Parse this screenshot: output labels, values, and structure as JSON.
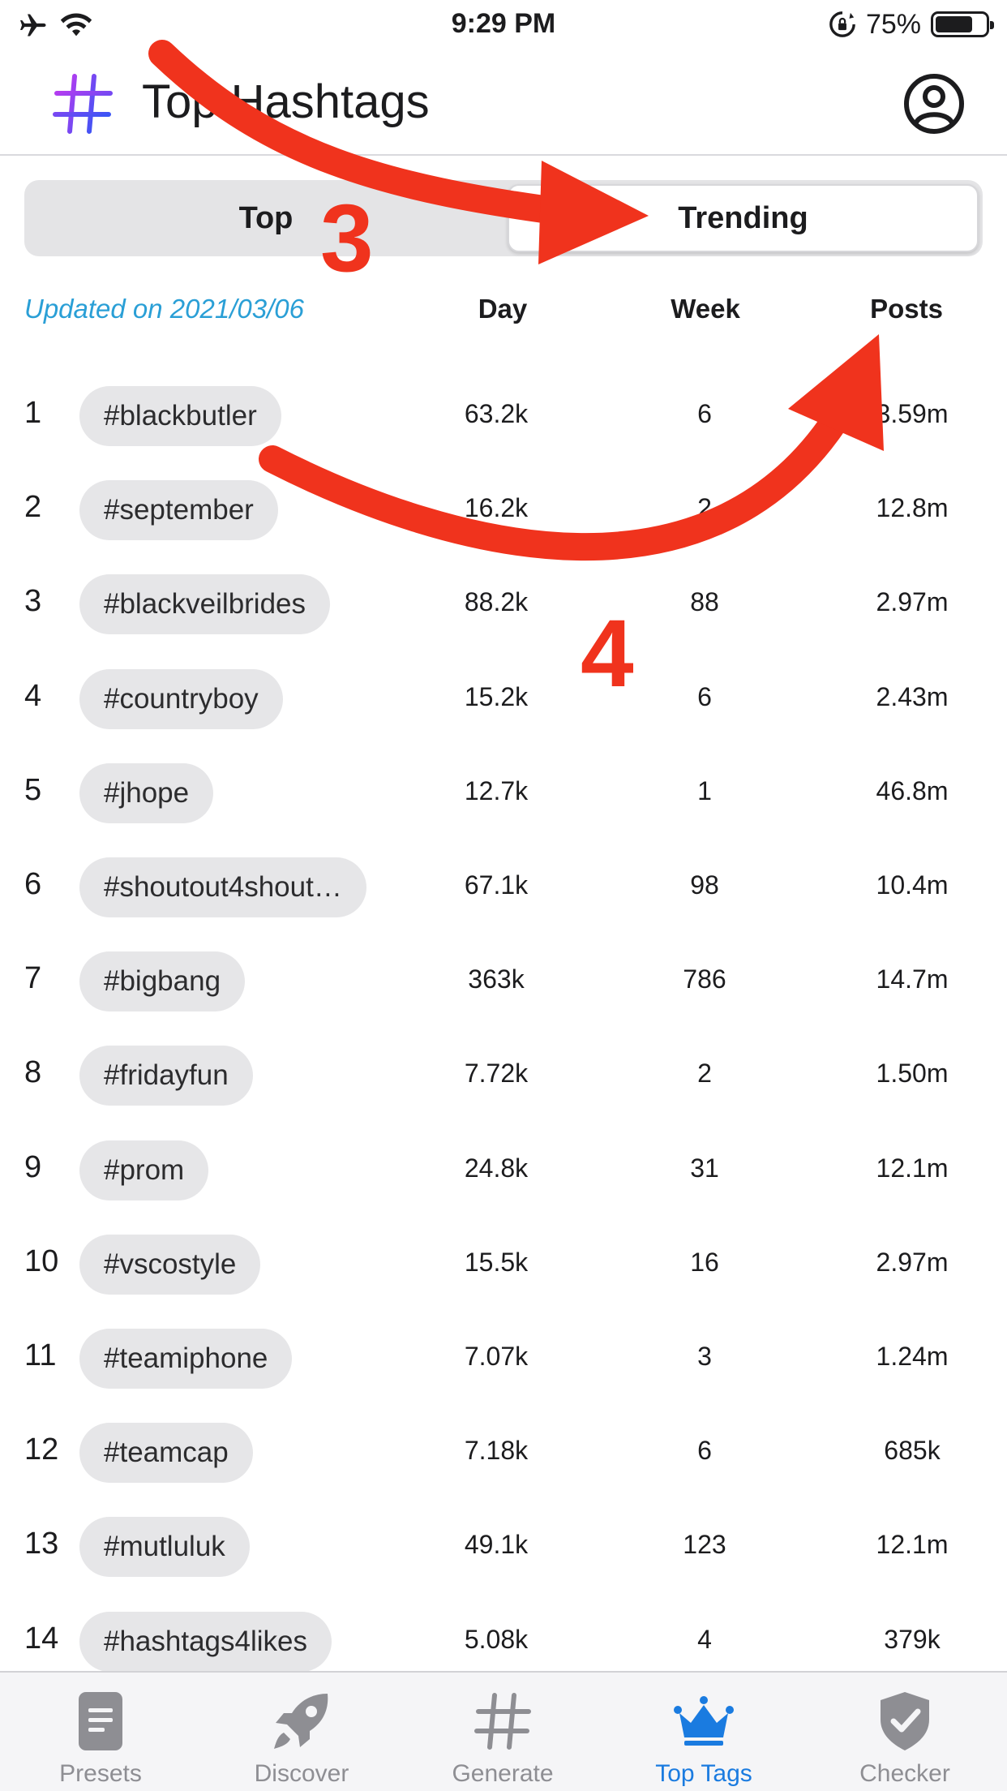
{
  "status_bar": {
    "time": "9:29 PM",
    "battery_percent": "75%",
    "battery_level": 0.75
  },
  "header": {
    "title": "Top Hashtags",
    "logo_icon": "hashtag-logo-icon",
    "profile_icon": "profile-icon"
  },
  "segmented": {
    "top_label": "Top",
    "trending_label": "Trending",
    "selected": "Trending"
  },
  "table": {
    "updated": "Updated on 2021/03/06",
    "headers": {
      "day": "Day",
      "week": "Week",
      "posts": "Posts"
    },
    "rows": [
      {
        "rank": "1",
        "tag": "#blackbutler",
        "day": "63.2k",
        "week": "6",
        "posts": "3.59m"
      },
      {
        "rank": "2",
        "tag": "#september",
        "day": "16.2k",
        "week": "2",
        "posts": "12.8m"
      },
      {
        "rank": "3",
        "tag": "#blackveilbrides",
        "day": "88.2k",
        "week": "88",
        "posts": "2.97m"
      },
      {
        "rank": "4",
        "tag": "#countryboy",
        "day": "15.2k",
        "week": "6",
        "posts": "2.43m"
      },
      {
        "rank": "5",
        "tag": "#jhope",
        "day": "12.7k",
        "week": "1",
        "posts": "46.8m"
      },
      {
        "rank": "6",
        "tag": "#shoutout4shout…",
        "day": "67.1k",
        "week": "98",
        "posts": "10.4m"
      },
      {
        "rank": "7",
        "tag": "#bigbang",
        "day": "363k",
        "week": "786",
        "posts": "14.7m"
      },
      {
        "rank": "8",
        "tag": "#fridayfun",
        "day": "7.72k",
        "week": "2",
        "posts": "1.50m"
      },
      {
        "rank": "9",
        "tag": "#prom",
        "day": "24.8k",
        "week": "31",
        "posts": "12.1m"
      },
      {
        "rank": "10",
        "tag": "#vscostyle",
        "day": "15.5k",
        "week": "16",
        "posts": "2.97m"
      },
      {
        "rank": "11",
        "tag": "#teamiphone",
        "day": "7.07k",
        "week": "3",
        "posts": "1.24m"
      },
      {
        "rank": "12",
        "tag": "#teamcap",
        "day": "7.18k",
        "week": "6",
        "posts": "685k"
      },
      {
        "rank": "13",
        "tag": "#mutluluk",
        "day": "49.1k",
        "week": "123",
        "posts": "12.1m"
      },
      {
        "rank": "14",
        "tag": "#hashtags4likes",
        "day": "5.08k",
        "week": "4",
        "posts": "379k"
      }
    ]
  },
  "tabbar": {
    "items": [
      {
        "label": "Presets",
        "icon": "presets-icon"
      },
      {
        "label": "Discover",
        "icon": "rocket-icon"
      },
      {
        "label": "Generate",
        "icon": "hashtag-icon"
      },
      {
        "label": "Top Tags",
        "icon": "crown-icon"
      },
      {
        "label": "Checker",
        "icon": "shield-check-icon"
      }
    ],
    "active": "Top Tags"
  },
  "annotations": {
    "step3": "3",
    "step4": "4"
  },
  "colors": {
    "accent_blue": "#1a7be0",
    "updated_text": "#2a9fd6",
    "annotation_red": "#f0331d",
    "chip_bg": "#e6e6e8"
  }
}
